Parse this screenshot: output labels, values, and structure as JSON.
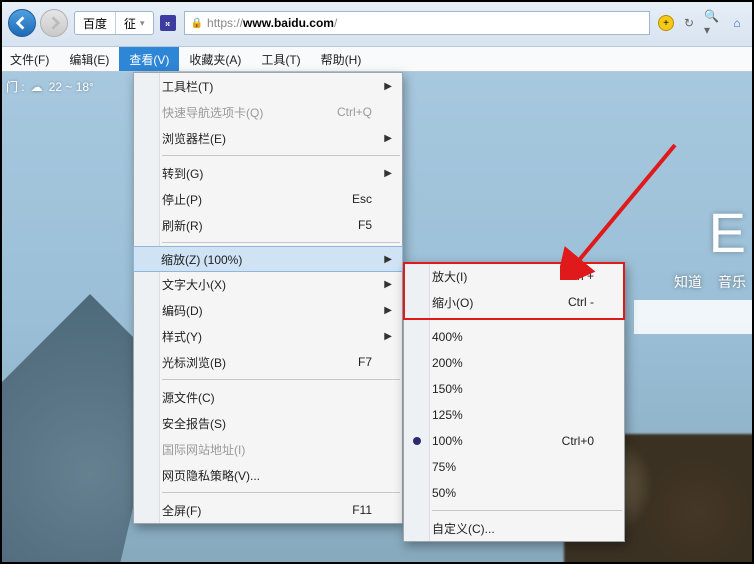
{
  "titlebar": {
    "tab1": "百度",
    "tab2": "征",
    "url_prefix": "https://",
    "url_host": "www.baidu.com",
    "url_path": "/"
  },
  "menubar": {
    "file": "文件(F)",
    "edit": "编辑(E)",
    "view": "查看(V)",
    "favorites": "收藏夹(A)",
    "tools": "工具(T)",
    "help": "帮助(H)"
  },
  "view_menu": {
    "toolbars": "工具栏(T)",
    "quicktabs": "快速导航选项卡(Q)",
    "quicktabs_shortcut": "Ctrl+Q",
    "explorer_bars": "浏览器栏(E)",
    "goto": "转到(G)",
    "stop": "停止(P)",
    "stop_shortcut": "Esc",
    "refresh": "刷新(R)",
    "refresh_shortcut": "F5",
    "zoom": "缩放(Z) (100%)",
    "text_size": "文字大小(X)",
    "encoding": "编码(D)",
    "style": "样式(Y)",
    "caret": "光标浏览(B)",
    "caret_shortcut": "F7",
    "source": "源文件(C)",
    "security": "安全报告(S)",
    "intl_site": "国际网站地址(I)",
    "privacy": "网页隐私策略(V)...",
    "fullscreen": "全屏(F)",
    "fullscreen_shortcut": "F11"
  },
  "zoom_menu": {
    "zoom_in": "放大(I)",
    "zoom_in_shortcut": "Ctrl +",
    "zoom_out": "缩小(O)",
    "zoom_out_shortcut": "Ctrl -",
    "p400": "400%",
    "p200": "200%",
    "p150": "150%",
    "p125": "125%",
    "p100": "100%",
    "p100_shortcut": "Ctrl+0",
    "p75": "75%",
    "p50": "50%",
    "custom": "自定义(C)..."
  },
  "page": {
    "weather_loc": "门 :",
    "weather_temp": "22 ~ 18°",
    "bd_initial": "E",
    "link_zhidao": "知道",
    "link_music": "音乐"
  }
}
